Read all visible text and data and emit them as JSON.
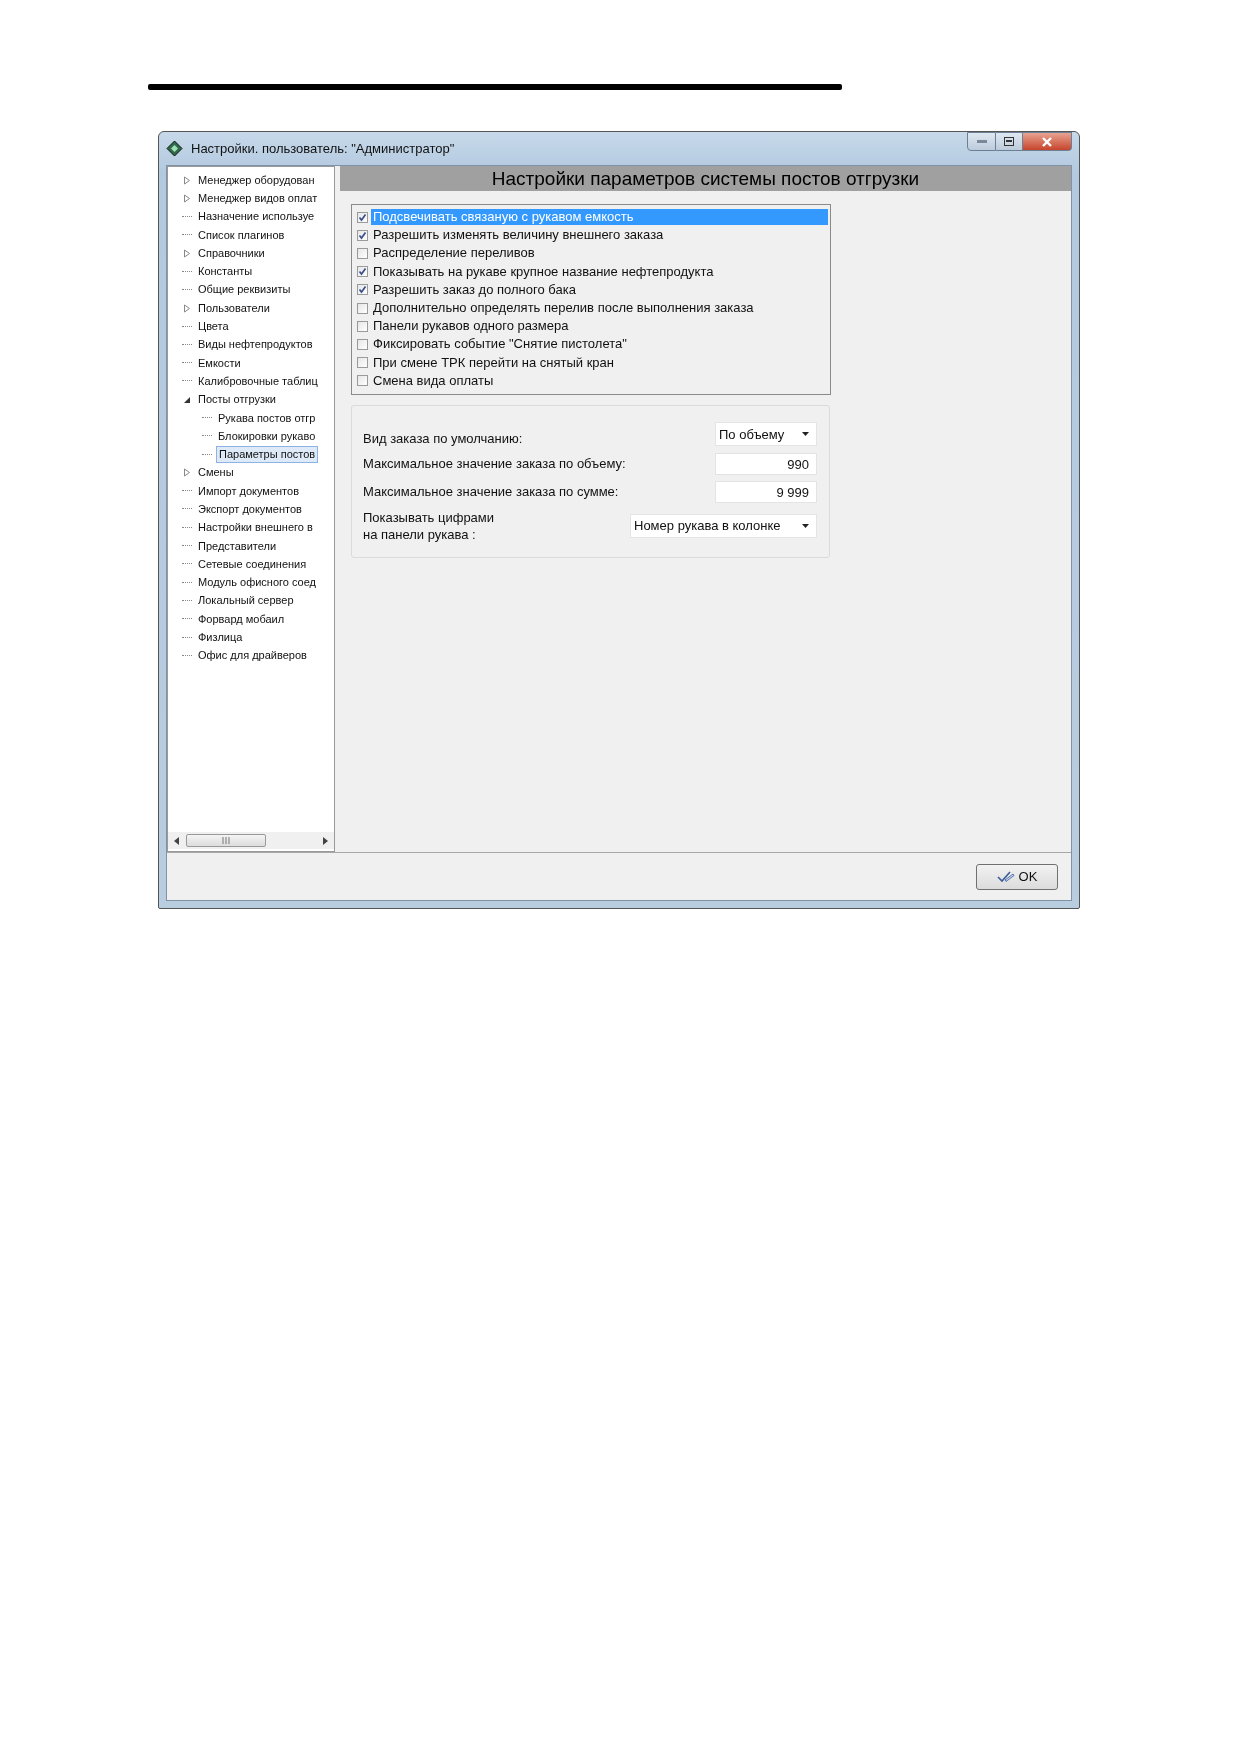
{
  "window": {
    "title": "Настройки. пользователь: \"Администратор\""
  },
  "tree": [
    {
      "label": "Менеджер оборудован",
      "expanded": false,
      "selected": false
    },
    {
      "label": "Менеджер видов оплат",
      "expanded": false,
      "selected": false
    },
    {
      "label": "Назначение используе",
      "selected": false
    },
    {
      "label": "Список плагинов",
      "selected": false
    },
    {
      "label": "Справочники",
      "expanded": false,
      "selected": false
    },
    {
      "label": "Константы",
      "selected": false
    },
    {
      "label": "Общие реквизиты",
      "selected": false
    },
    {
      "label": "Пользователи",
      "expanded": false,
      "selected": false
    },
    {
      "label": "Цвета",
      "selected": false
    },
    {
      "label": "Виды нефтепродуктов",
      "selected": false
    },
    {
      "label": "Емкости",
      "selected": false
    },
    {
      "label": "Калибровочные таблиц",
      "selected": false
    },
    {
      "label": "Посты отгрузки",
      "expanded": true,
      "selected": false,
      "children": [
        {
          "label": "Рукава постов отгр",
          "selected": false
        },
        {
          "label": "Блокировки рукаво",
          "selected": false
        },
        {
          "label": "Параметры постов",
          "selected": true
        }
      ]
    },
    {
      "label": "Смены",
      "expanded": false,
      "selected": false
    },
    {
      "label": "Импорт документов",
      "selected": false
    },
    {
      "label": "Экспорт документов",
      "selected": false
    },
    {
      "label": "Настройки внешнего в",
      "selected": false
    },
    {
      "label": "Представители",
      "selected": false
    },
    {
      "label": "Сетевые соединения",
      "selected": false
    },
    {
      "label": "Модуль офисного соед",
      "selected": false
    },
    {
      "label": "Локальный сервер",
      "selected": false
    },
    {
      "label": "Форвард мобаил",
      "selected": false
    },
    {
      "label": "Физлица",
      "selected": false
    },
    {
      "label": "Офис для драйверов",
      "selected": false
    }
  ],
  "panel": {
    "title": "Настройки параметров системы постов отгрузки",
    "options": [
      {
        "label": "Подсвечивать связаную с рукавом емкость",
        "checked": true,
        "selected": true
      },
      {
        "label": "Разрешить изменять величину внешнего заказа",
        "checked": true,
        "selected": false
      },
      {
        "label": "Распределение переливов",
        "checked": false,
        "selected": false
      },
      {
        "label": "Показывать на рукаве крупное название нефтепродукта",
        "checked": true,
        "selected": false
      },
      {
        "label": "Разрешить заказ до полного бака",
        "checked": true,
        "selected": false
      },
      {
        "label": "Дополнительно определять перелив после выполнения заказа",
        "checked": false,
        "selected": false
      },
      {
        "label": "Панели рукавов одного размера",
        "checked": false,
        "selected": false
      },
      {
        "label": "Фиксировать событие \"Снятие пистолета\"",
        "checked": false,
        "selected": false
      },
      {
        "label": "При смене ТРК перейти на снятый кран",
        "checked": false,
        "selected": false
      },
      {
        "label": "Смена вида оплаты",
        "checked": false,
        "selected": false
      }
    ],
    "fields": [
      {
        "kind": "dropdown",
        "label": "Вид заказа по умолчанию:",
        "value": "По объему"
      },
      {
        "kind": "number",
        "label": "Максимальное значение заказа по объему:",
        "value": "990"
      },
      {
        "kind": "number",
        "label": "Максимальное значение заказа по сумме:",
        "value": "9 999"
      },
      {
        "kind": "wide-dropdown",
        "label": "Показывать цифрами\nна панели рукава :",
        "value": "Номер рукава в колонке"
      }
    ]
  },
  "buttons": [
    {
      "label": "OK"
    }
  ]
}
